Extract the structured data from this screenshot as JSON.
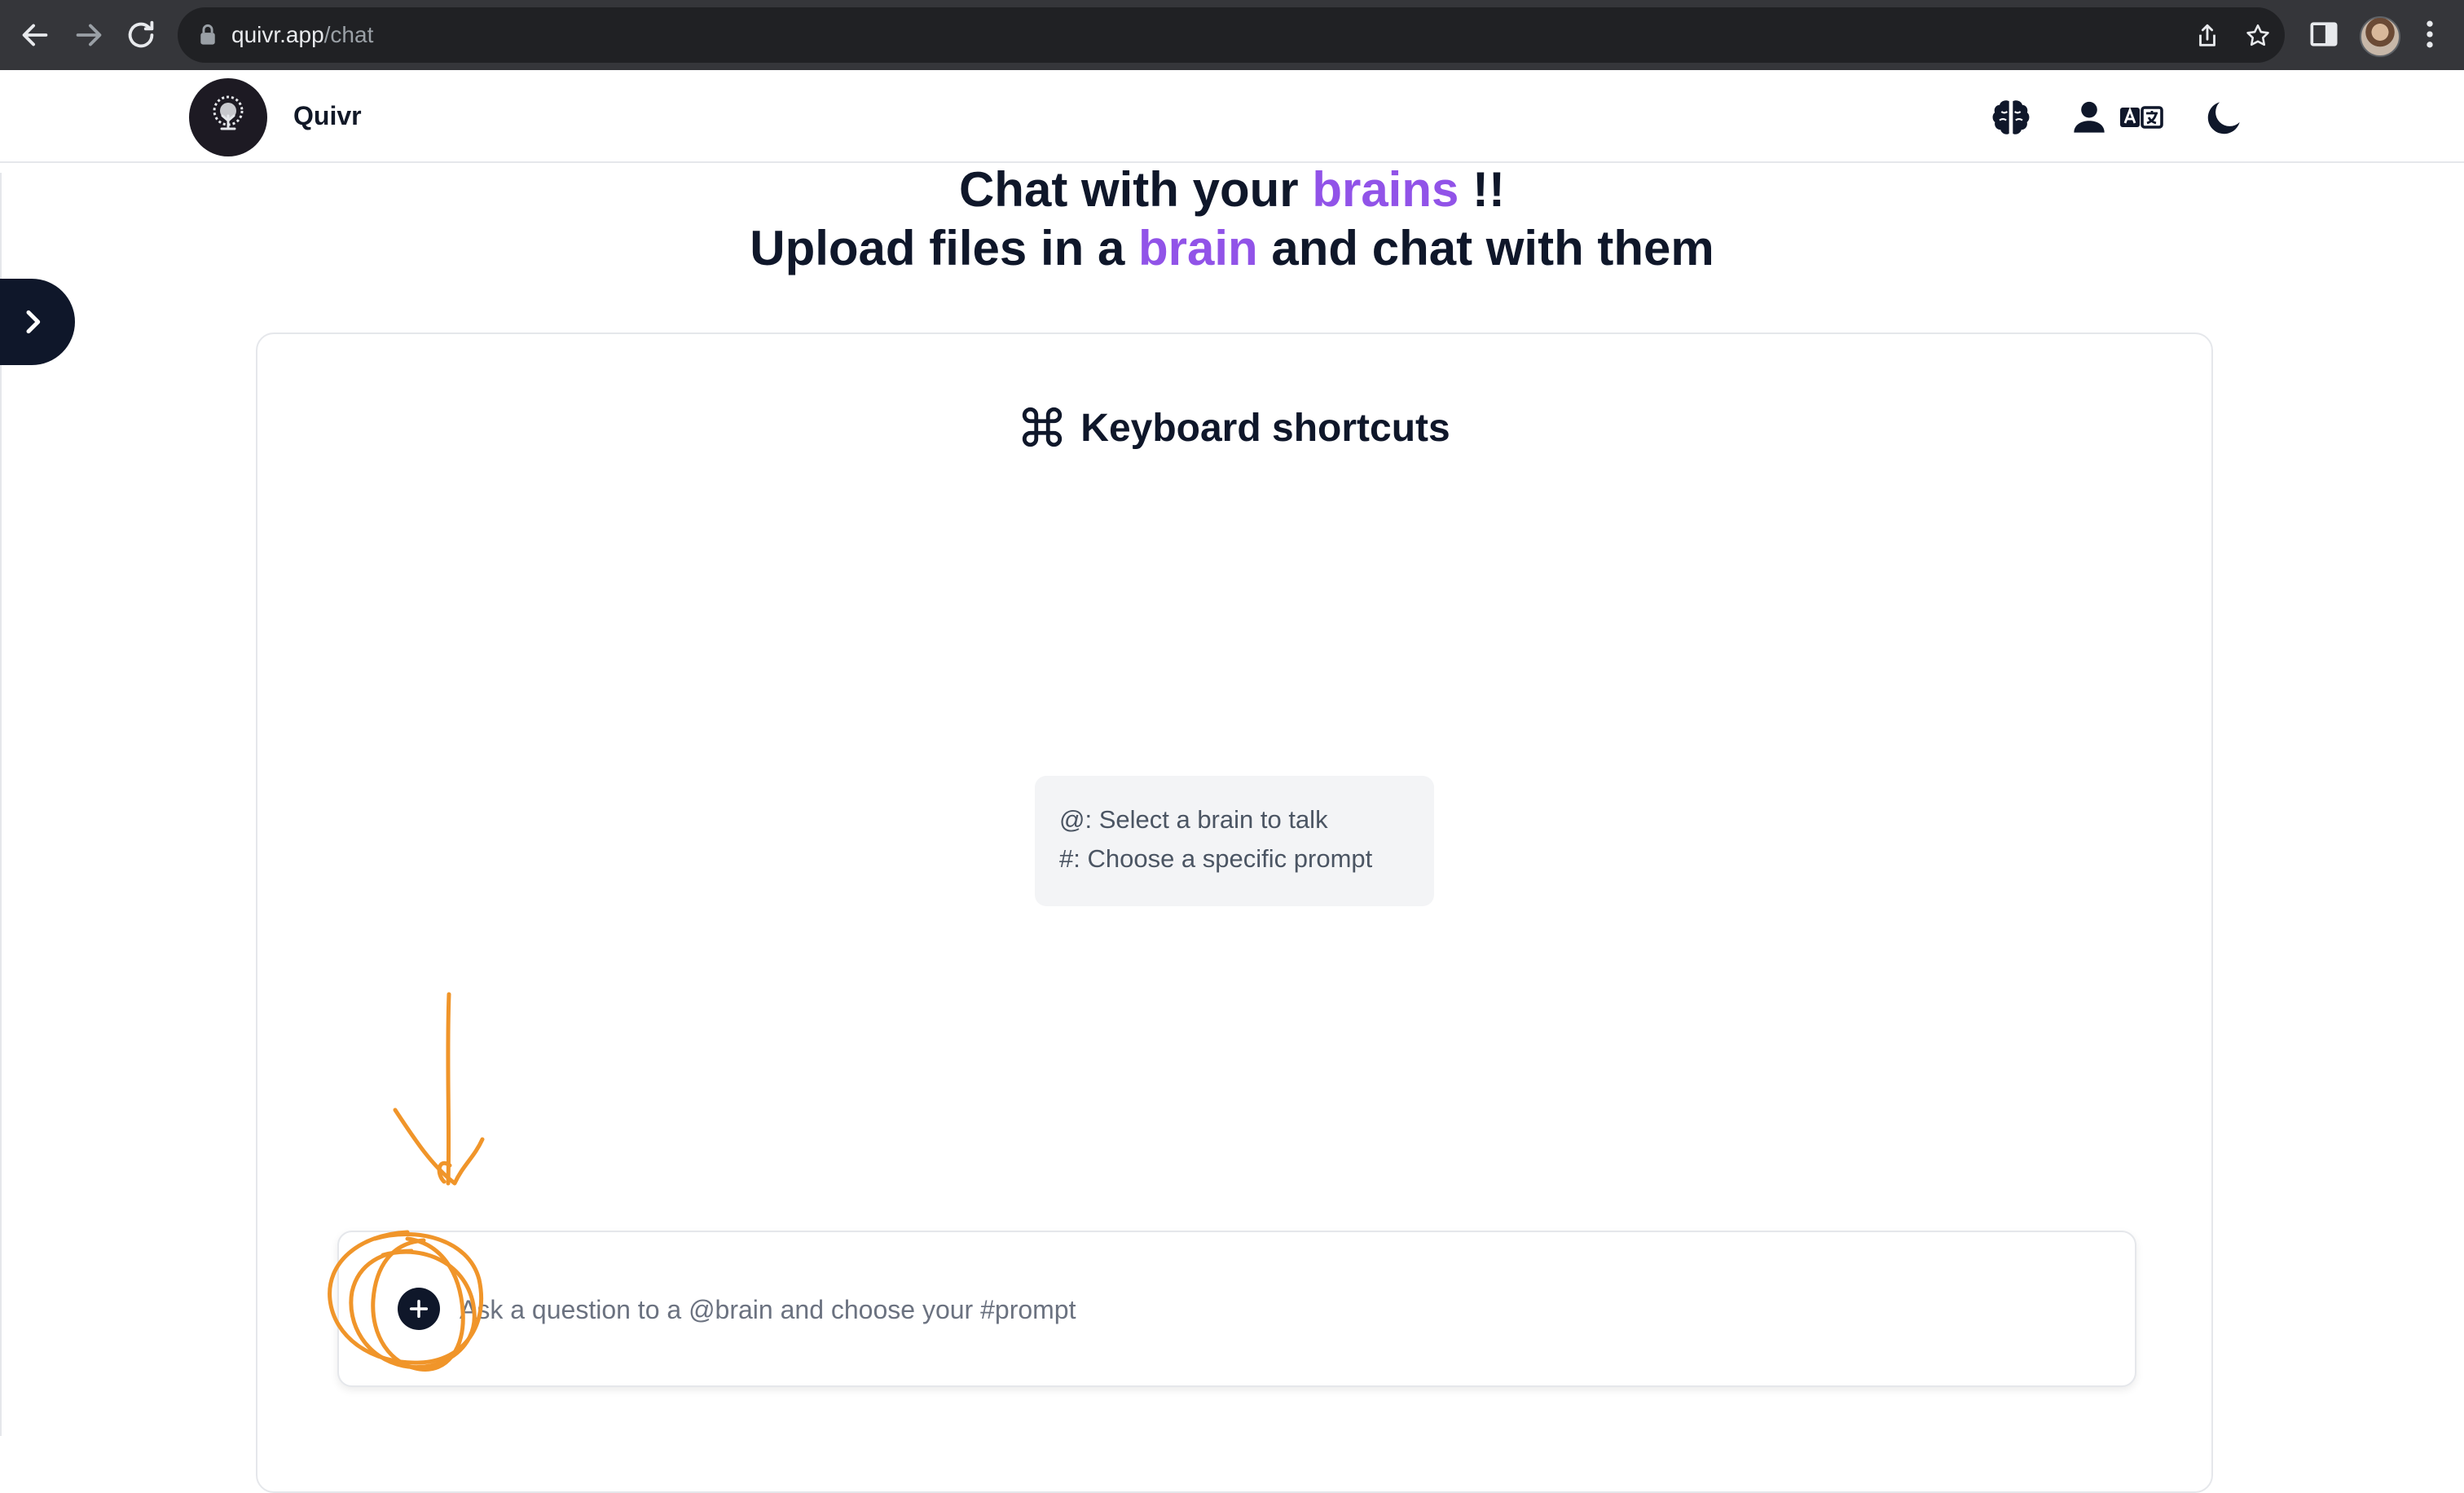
{
  "browser": {
    "url_host": "quivr.app",
    "url_path": "/chat",
    "icons": [
      "back-arrow-icon",
      "forward-arrow-icon",
      "reload-icon",
      "lock-icon",
      "share-icon",
      "star-icon",
      "side-panel-icon",
      "profile-avatar",
      "kebab-menu-icon"
    ]
  },
  "header": {
    "brand": "Quivr",
    "icons": [
      "brain-icon",
      "user-icon",
      "translate-icon",
      "moon-icon"
    ]
  },
  "hero": {
    "line1_prefix": "Chat with your ",
    "line1_accent": "brains",
    "line1_suffix": " !!",
    "line2_prefix": "Upload files in a ",
    "line2_accent": "brain",
    "line2_suffix": " and chat with them",
    "accent_color": "#9153e8"
  },
  "shortcuts": {
    "title": "Keyboard shortcuts",
    "tips": [
      "@: Select a brain to talk",
      "#: Choose a specific prompt"
    ]
  },
  "chat": {
    "placeholder": "Ask a question to a @brain and choose your #prompt",
    "value": ""
  },
  "annotation_color": "#f0952a"
}
